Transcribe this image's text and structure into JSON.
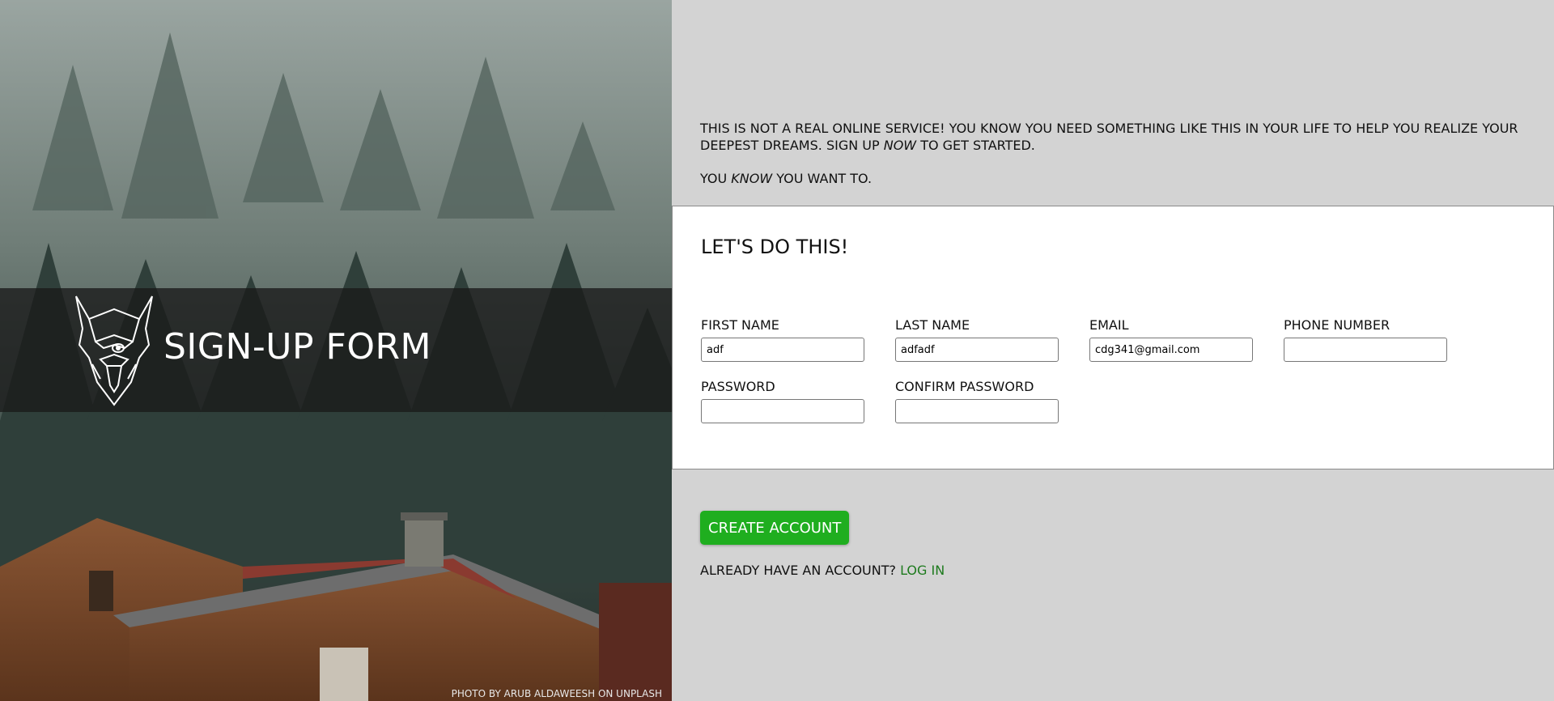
{
  "left": {
    "brand_title": "SIGN-UP FORM",
    "photo_credit": "PHOTO BY ARUB ALDAWEESH ON UNPLASH"
  },
  "intro": {
    "line1_a": "THIS IS NOT A REAL ONLINE SERVICE! YOU KNOW YOU NEED SOMETHING LIKE THIS IN YOUR LIFE TO HELP YOU REALIZE YOUR DEEPEST DREAMS. SIGN UP ",
    "line1_em": "NOW",
    "line1_b": " TO GET STARTED.",
    "line2_a": "YOU ",
    "line2_em": "KNOW",
    "line2_b": " YOU WANT TO."
  },
  "form": {
    "heading": "LET'S DO THIS!",
    "first_name": {
      "label": "FIRST NAME",
      "value": "adf"
    },
    "last_name": {
      "label": "LAST NAME",
      "value": "adfadf"
    },
    "email": {
      "label": "EMAIL",
      "value": "cdg341@gmail.com"
    },
    "phone": {
      "label": "PHONE NUMBER",
      "value": ""
    },
    "password": {
      "label": "PASSWORD",
      "value": ""
    },
    "confirm_password": {
      "label": "CONFIRM PASSWORD",
      "value": ""
    }
  },
  "actions": {
    "create_account": "CREATE ACCOUNT",
    "already_text": "ALREADY HAVE AN ACCOUNT? ",
    "login_link": "LOG IN"
  },
  "colors": {
    "accent_green": "#1fae1f",
    "link_green": "#1d7a1d",
    "panel_gray": "#d3d3d3"
  }
}
